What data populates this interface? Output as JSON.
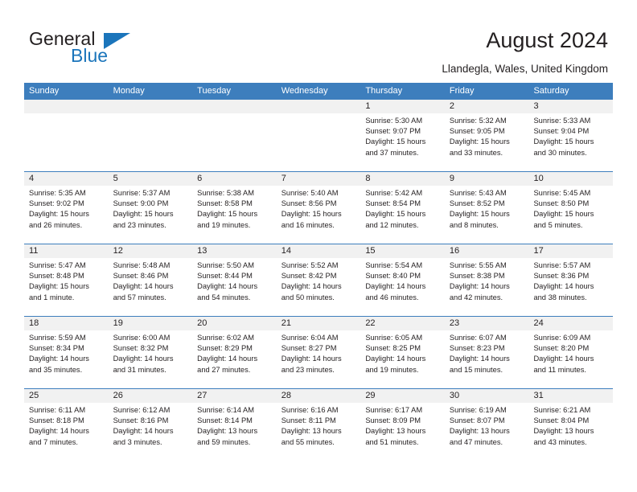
{
  "brand": {
    "name_part1": "General",
    "name_part2": "Blue",
    "logo_icon": "triangle-icon"
  },
  "header": {
    "title": "August 2024",
    "location": "Llandegla, Wales, United Kingdom"
  },
  "colors": {
    "header_blue": "#3d7ebd",
    "brand_blue": "#1b75bb",
    "date_band": "#f1f1f1",
    "text": "#231f20"
  },
  "weekdays": [
    "Sunday",
    "Monday",
    "Tuesday",
    "Wednesday",
    "Thursday",
    "Friday",
    "Saturday"
  ],
  "weeks": [
    [
      {
        "day": "",
        "lines": []
      },
      {
        "day": "",
        "lines": []
      },
      {
        "day": "",
        "lines": []
      },
      {
        "day": "",
        "lines": []
      },
      {
        "day": "1",
        "lines": [
          "Sunrise: 5:30 AM",
          "Sunset: 9:07 PM",
          "Daylight: 15 hours",
          "and 37 minutes."
        ]
      },
      {
        "day": "2",
        "lines": [
          "Sunrise: 5:32 AM",
          "Sunset: 9:05 PM",
          "Daylight: 15 hours",
          "and 33 minutes."
        ]
      },
      {
        "day": "3",
        "lines": [
          "Sunrise: 5:33 AM",
          "Sunset: 9:04 PM",
          "Daylight: 15 hours",
          "and 30 minutes."
        ]
      }
    ],
    [
      {
        "day": "4",
        "lines": [
          "Sunrise: 5:35 AM",
          "Sunset: 9:02 PM",
          "Daylight: 15 hours",
          "and 26 minutes."
        ]
      },
      {
        "day": "5",
        "lines": [
          "Sunrise: 5:37 AM",
          "Sunset: 9:00 PM",
          "Daylight: 15 hours",
          "and 23 minutes."
        ]
      },
      {
        "day": "6",
        "lines": [
          "Sunrise: 5:38 AM",
          "Sunset: 8:58 PM",
          "Daylight: 15 hours",
          "and 19 minutes."
        ]
      },
      {
        "day": "7",
        "lines": [
          "Sunrise: 5:40 AM",
          "Sunset: 8:56 PM",
          "Daylight: 15 hours",
          "and 16 minutes."
        ]
      },
      {
        "day": "8",
        "lines": [
          "Sunrise: 5:42 AM",
          "Sunset: 8:54 PM",
          "Daylight: 15 hours",
          "and 12 minutes."
        ]
      },
      {
        "day": "9",
        "lines": [
          "Sunrise: 5:43 AM",
          "Sunset: 8:52 PM",
          "Daylight: 15 hours",
          "and 8 minutes."
        ]
      },
      {
        "day": "10",
        "lines": [
          "Sunrise: 5:45 AM",
          "Sunset: 8:50 PM",
          "Daylight: 15 hours",
          "and 5 minutes."
        ]
      }
    ],
    [
      {
        "day": "11",
        "lines": [
          "Sunrise: 5:47 AM",
          "Sunset: 8:48 PM",
          "Daylight: 15 hours",
          "and 1 minute."
        ]
      },
      {
        "day": "12",
        "lines": [
          "Sunrise: 5:48 AM",
          "Sunset: 8:46 PM",
          "Daylight: 14 hours",
          "and 57 minutes."
        ]
      },
      {
        "day": "13",
        "lines": [
          "Sunrise: 5:50 AM",
          "Sunset: 8:44 PM",
          "Daylight: 14 hours",
          "and 54 minutes."
        ]
      },
      {
        "day": "14",
        "lines": [
          "Sunrise: 5:52 AM",
          "Sunset: 8:42 PM",
          "Daylight: 14 hours",
          "and 50 minutes."
        ]
      },
      {
        "day": "15",
        "lines": [
          "Sunrise: 5:54 AM",
          "Sunset: 8:40 PM",
          "Daylight: 14 hours",
          "and 46 minutes."
        ]
      },
      {
        "day": "16",
        "lines": [
          "Sunrise: 5:55 AM",
          "Sunset: 8:38 PM",
          "Daylight: 14 hours",
          "and 42 minutes."
        ]
      },
      {
        "day": "17",
        "lines": [
          "Sunrise: 5:57 AM",
          "Sunset: 8:36 PM",
          "Daylight: 14 hours",
          "and 38 minutes."
        ]
      }
    ],
    [
      {
        "day": "18",
        "lines": [
          "Sunrise: 5:59 AM",
          "Sunset: 8:34 PM",
          "Daylight: 14 hours",
          "and 35 minutes."
        ]
      },
      {
        "day": "19",
        "lines": [
          "Sunrise: 6:00 AM",
          "Sunset: 8:32 PM",
          "Daylight: 14 hours",
          "and 31 minutes."
        ]
      },
      {
        "day": "20",
        "lines": [
          "Sunrise: 6:02 AM",
          "Sunset: 8:29 PM",
          "Daylight: 14 hours",
          "and 27 minutes."
        ]
      },
      {
        "day": "21",
        "lines": [
          "Sunrise: 6:04 AM",
          "Sunset: 8:27 PM",
          "Daylight: 14 hours",
          "and 23 minutes."
        ]
      },
      {
        "day": "22",
        "lines": [
          "Sunrise: 6:05 AM",
          "Sunset: 8:25 PM",
          "Daylight: 14 hours",
          "and 19 minutes."
        ]
      },
      {
        "day": "23",
        "lines": [
          "Sunrise: 6:07 AM",
          "Sunset: 8:23 PM",
          "Daylight: 14 hours",
          "and 15 minutes."
        ]
      },
      {
        "day": "24",
        "lines": [
          "Sunrise: 6:09 AM",
          "Sunset: 8:20 PM",
          "Daylight: 14 hours",
          "and 11 minutes."
        ]
      }
    ],
    [
      {
        "day": "25",
        "lines": [
          "Sunrise: 6:11 AM",
          "Sunset: 8:18 PM",
          "Daylight: 14 hours",
          "and 7 minutes."
        ]
      },
      {
        "day": "26",
        "lines": [
          "Sunrise: 6:12 AM",
          "Sunset: 8:16 PM",
          "Daylight: 14 hours",
          "and 3 minutes."
        ]
      },
      {
        "day": "27",
        "lines": [
          "Sunrise: 6:14 AM",
          "Sunset: 8:14 PM",
          "Daylight: 13 hours",
          "and 59 minutes."
        ]
      },
      {
        "day": "28",
        "lines": [
          "Sunrise: 6:16 AM",
          "Sunset: 8:11 PM",
          "Daylight: 13 hours",
          "and 55 minutes."
        ]
      },
      {
        "day": "29",
        "lines": [
          "Sunrise: 6:17 AM",
          "Sunset: 8:09 PM",
          "Daylight: 13 hours",
          "and 51 minutes."
        ]
      },
      {
        "day": "30",
        "lines": [
          "Sunrise: 6:19 AM",
          "Sunset: 8:07 PM",
          "Daylight: 13 hours",
          "and 47 minutes."
        ]
      },
      {
        "day": "31",
        "lines": [
          "Sunrise: 6:21 AM",
          "Sunset: 8:04 PM",
          "Daylight: 13 hours",
          "and 43 minutes."
        ]
      }
    ]
  ]
}
